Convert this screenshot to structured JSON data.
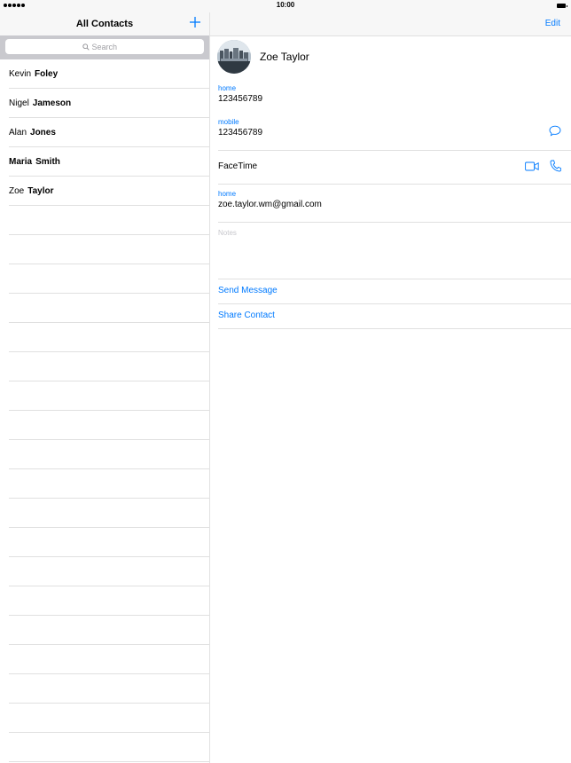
{
  "status_bar": {
    "time": "10:00"
  },
  "master": {
    "title": "All Contacts",
    "search": {
      "placeholder": "Search"
    },
    "contacts": [
      {
        "first": "Kevin",
        "last": "Foley"
      },
      {
        "first": "Nigel",
        "last": "Jameson"
      },
      {
        "first": "Alan",
        "last": "Jones"
      },
      {
        "first": "Maria",
        "last": "Smith"
      },
      {
        "first": "Zoe",
        "last": "Taylor"
      }
    ]
  },
  "detail": {
    "edit_label": "Edit",
    "name": "Zoe Taylor",
    "fields": [
      {
        "label": "home",
        "value": "123456789"
      },
      {
        "label": "mobile",
        "value": "123456789"
      }
    ],
    "facetime_label": "FaceTime",
    "email": {
      "label": "home",
      "value": "zoe.taylor.wm@gmail.com"
    },
    "notes_placeholder": "Notes",
    "actions": {
      "send_message": "Send Message",
      "share_contact": "Share Contact"
    }
  },
  "colors": {
    "accent": "#007aff",
    "separator": "#e0e0e0",
    "bar": "#f7f7f7",
    "search_bg": "#c9c9ce"
  },
  "icons": [
    "signal-dots-icon",
    "battery-icon",
    "plus-icon",
    "search-icon",
    "message-bubble-icon",
    "video-camera-icon",
    "phone-icon"
  ]
}
